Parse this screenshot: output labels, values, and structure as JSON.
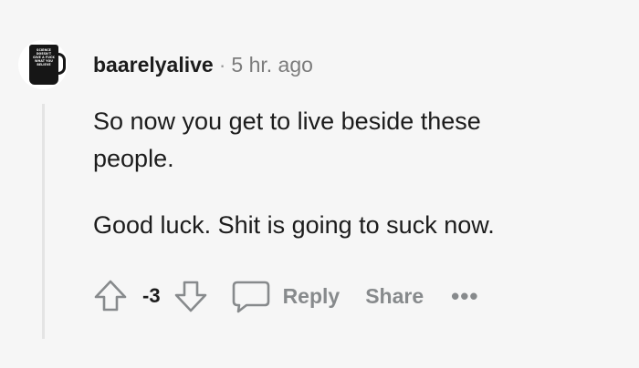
{
  "avatar": {
    "mug_text": [
      "SCIENCE",
      "DOESN'T",
      "GIVE A FUCK",
      "WHAT YOU",
      "BELIEVE"
    ]
  },
  "comment": {
    "username": "baarelyalive",
    "separator": "·",
    "timestamp": "5 hr. ago",
    "paragraphs": [
      "So now you get to live beside these people.",
      "Good luck. Shit is going to suck now."
    ]
  },
  "actions": {
    "score": "-3",
    "upvote_icon": "arrow-up-outline-icon",
    "downvote_icon": "arrow-down-outline-icon",
    "reply_icon": "speech-bubble-icon",
    "reply_label": "Reply",
    "share_label": "Share",
    "more_label": "•••"
  },
  "colors": {
    "background": "#f6f6f6",
    "text": "#1c1c1c",
    "muted": "#878a8c",
    "thread_line": "#e4e4e4"
  }
}
